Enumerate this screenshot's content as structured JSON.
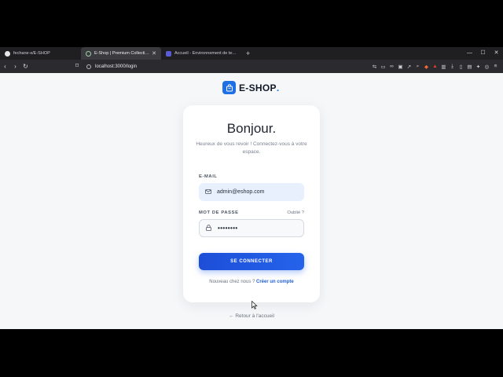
{
  "tabs": [
    {
      "label": "fechane-s/E-SHOP",
      "icon": "github-icon"
    },
    {
      "label": "E-Shop | Premium Collection",
      "icon": "globe-icon"
    },
    {
      "label": "Accueil - Environnement de test /Ne...",
      "icon": "app-icon"
    }
  ],
  "browser": {
    "url": "localhost:3000/login"
  },
  "brand": {
    "name": "E-SHOP",
    "dot": "."
  },
  "login": {
    "title": "Bonjour.",
    "subtitle": "Heureux de vous revoir ! Connectez-vous à votre espace.",
    "email_label": "E-MAIL",
    "email_value": "admin@eshop.com",
    "password_label": "MOT DE PASSE",
    "forgot_label": "Oublié ?",
    "password_value": "••••••••",
    "submit_label": "SE CONNECTER",
    "signup_prompt": "Nouveau chez nous ?",
    "signup_link": "Créer un compte"
  },
  "back_link": "Retour à l'accueil",
  "colors": {
    "accent": "#1f6fe5",
    "button": "#2563eb"
  }
}
